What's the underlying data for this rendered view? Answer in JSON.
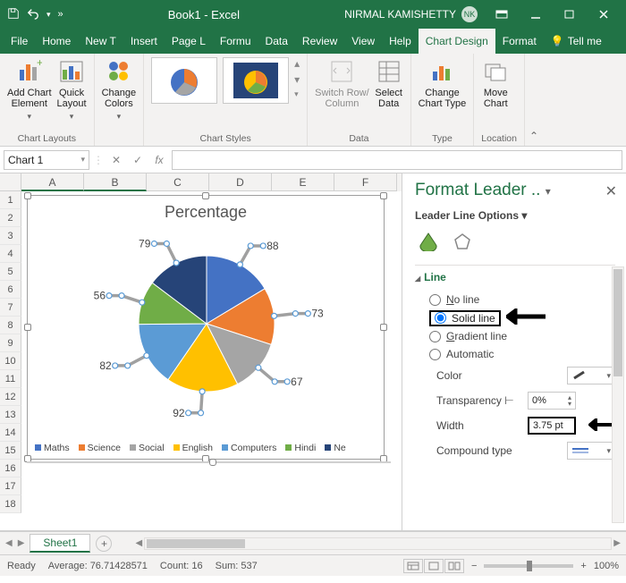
{
  "titlebar": {
    "doc_title": "Book1 - Excel",
    "user_name": "NIRMAL KAMISHETTY",
    "user_initials": "NK"
  },
  "tabs": {
    "file": "File",
    "home": "Home",
    "newt": "New T",
    "insert": "Insert",
    "pagel": "Page L",
    "formu": "Formu",
    "data": "Data",
    "review": "Review",
    "view": "View",
    "help": "Help",
    "chartdesign": "Chart Design",
    "format": "Format",
    "tellme": "Tell me"
  },
  "ribbon": {
    "add_chart_element": "Add Chart\nElement",
    "quick_layout": "Quick\nLayout",
    "change_colors": "Change\nColors",
    "switch_rowcol": "Switch Row/\nColumn",
    "select_data": "Select\nData",
    "change_chart_type": "Change\nChart Type",
    "move_chart": "Move\nChart",
    "grp_layouts": "Chart Layouts",
    "grp_styles": "Chart Styles",
    "grp_data": "Data",
    "grp_type": "Type",
    "grp_location": "Location"
  },
  "namebox": {
    "value": "Chart 1",
    "fx": "fx"
  },
  "columns": [
    "A",
    "B",
    "C",
    "D",
    "E",
    "F"
  ],
  "rows": [
    "1",
    "2",
    "3",
    "4",
    "5",
    "6",
    "7",
    "8",
    "9",
    "10",
    "11",
    "12",
    "13",
    "14",
    "15",
    "16",
    "17",
    "18"
  ],
  "chart_data": {
    "type": "pie",
    "title": "Percentage",
    "categories": [
      "Maths",
      "Science",
      "Social",
      "English",
      "Computers",
      "Hindi",
      "Ne"
    ],
    "values": [
      88,
      73,
      67,
      92,
      82,
      56,
      79
    ],
    "colors": [
      "#4472C4",
      "#ED7D31",
      "#A5A5A5",
      "#FFC000",
      "#5B9BD5",
      "#70AD47",
      "#264478"
    ],
    "legend_position": "bottom"
  },
  "pane": {
    "title": "Format Leader ..",
    "subhead": "Leader Line Options",
    "section": "Line",
    "opts": {
      "noline": "No line",
      "solid": "Solid line",
      "gradient": "Gradient line",
      "automatic": "Automatic"
    },
    "selected_opt": "solid",
    "color_label": "Color",
    "transparency_label": "Transparency",
    "transparency_value": "0%",
    "width_label": "Width",
    "width_value": "3.75 pt",
    "compound_label": "Compound type"
  },
  "sheet_tab": "Sheet1",
  "status": {
    "ready": "Ready",
    "average_label": "Average:",
    "average": "76.71428571",
    "count_label": "Count:",
    "count": "16",
    "sum_label": "Sum:",
    "sum": "537",
    "zoom": "100%"
  }
}
